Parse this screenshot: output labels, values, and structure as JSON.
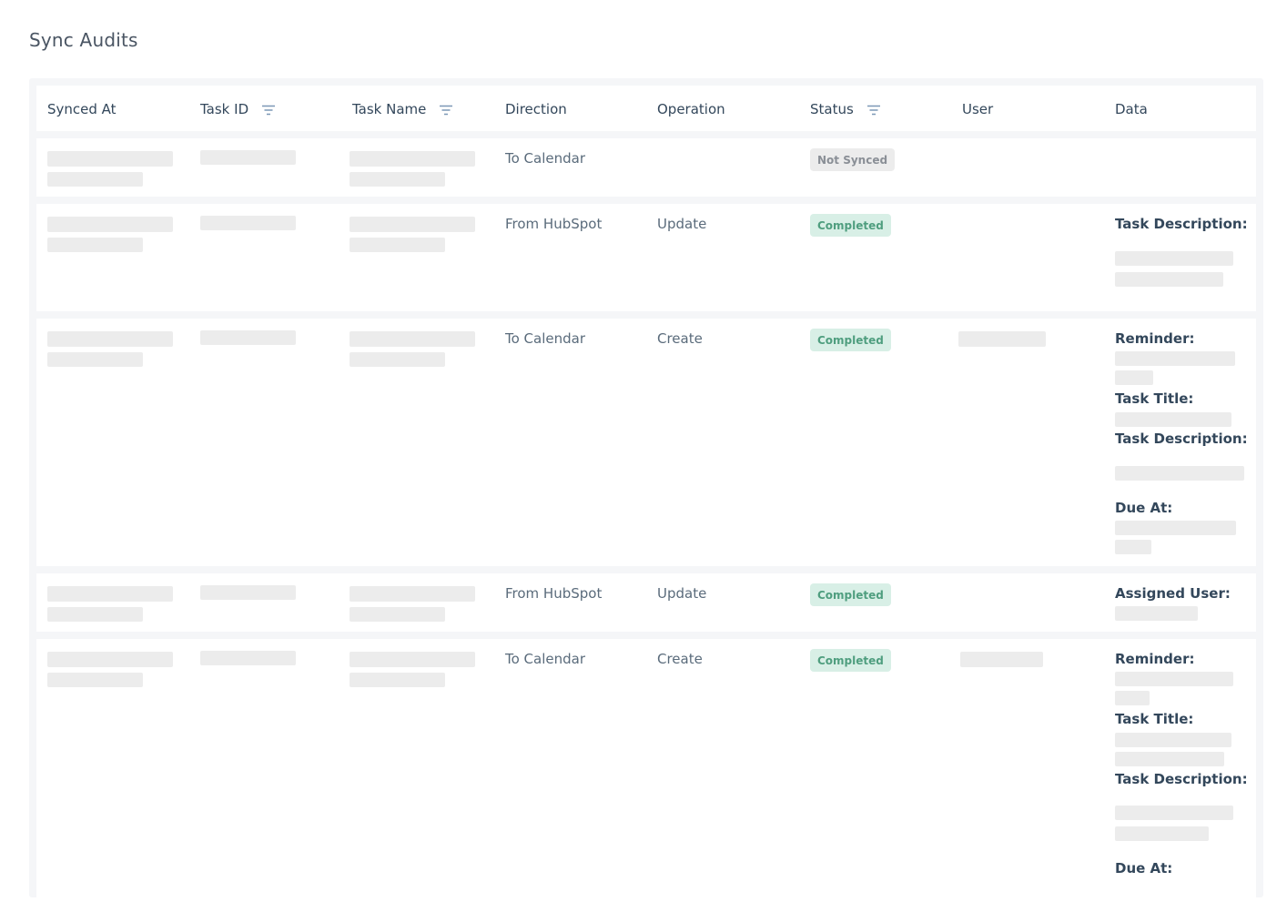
{
  "page": {
    "title": "Sync Audits"
  },
  "table": {
    "headers": [
      "Synced At",
      "Task ID",
      "Task Name",
      "Direction",
      "Operation",
      "Status",
      "User",
      "Data"
    ],
    "rows": [
      {
        "direction": "To Calendar",
        "operation": "",
        "status": "Not Synced",
        "data_labels": []
      },
      {
        "direction": "From HubSpot",
        "operation": "Update",
        "status": "Completed",
        "data_labels": [
          "Task Description:"
        ]
      },
      {
        "direction": "To Calendar",
        "operation": "Create",
        "status": "Completed",
        "data_labels": [
          "Reminder:",
          "Task Title:",
          "Task Description:",
          "Due At:"
        ]
      },
      {
        "direction": "From HubSpot",
        "operation": "Update",
        "status": "Completed",
        "data_labels": [
          "Assigned User:"
        ]
      },
      {
        "direction": "To Calendar",
        "operation": "Create",
        "status": "Completed",
        "data_labels": [
          "Reminder:",
          "Task Title:",
          "Task Description:",
          "Due At:"
        ]
      }
    ]
  },
  "colors": {
    "completed_bg": "#d8efe6",
    "completed_text": "#4f9e7f",
    "not_synced_bg": "#ececec",
    "not_synced_text": "#8a8f96",
    "skeleton": "#ececec"
  },
  "icons": {
    "filter": "filter-icon"
  }
}
